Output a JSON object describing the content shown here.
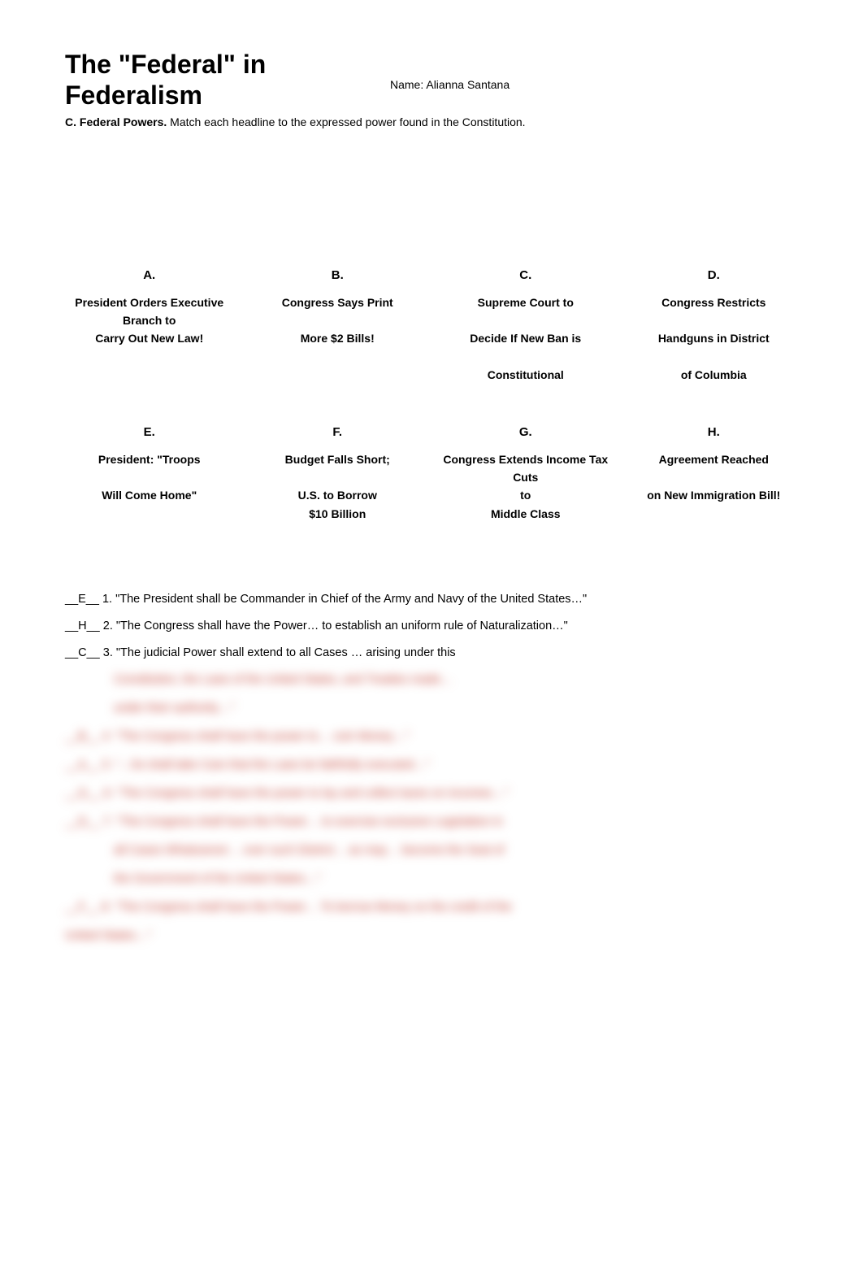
{
  "title_line1": "The \"Federal\" in",
  "title_line2": "Federalism",
  "name_label": "Name: ",
  "name_value": "Alianna Santana",
  "instructions_bold": "C. Federal Powers.",
  "instructions_rest": " Match each headline to the expressed power found in the Constitution.",
  "headlines": {
    "row1": [
      {
        "letter": "A.",
        "text": "President Orders Executive Branch to\nCarry Out New Law!"
      },
      {
        "letter": "B.",
        "text": "Congress Says Print\n \nMore $2 Bills!"
      },
      {
        "letter": "C.",
        "text": "Supreme Court to\n \nDecide If New Ban is\n \nConstitutional"
      },
      {
        "letter": "D.",
        "text": "Congress Restricts\n \nHandguns in District\n \nof Columbia"
      }
    ],
    "row2": [
      {
        "letter": "E.",
        "text": "President: \"Troops\n \nWill Come Home\""
      },
      {
        "letter": "F.",
        "text": "Budget Falls Short;\n \nU.S. to Borrow\n$10 Billion"
      },
      {
        "letter": "G.",
        "text": "Congress Extends Income Tax Cuts\nto\nMiddle Class"
      },
      {
        "letter": "H.",
        "text": "Agreement Reached\n \non New Immigration Bill!"
      }
    ]
  },
  "questions": {
    "q1": "__E__ 1. \"The President shall be Commander in Chief of the Army and Navy of the United States…\"",
    "q2": " __H__ 2. \"The Congress shall have the Power… to establish an uniform rule of Naturalization…\"",
    "q3_visible": "__C__ 3. \"The judicial Power shall extend to all Cases … arising under this",
    "q3_blurred1": "Constitution, the Laws of the United States, and Treaties made…",
    "q3_blurred2": "under their authority…\"",
    "q4": "__B__ 4. \"The Congress shall have the power to… coin Money…\"",
    "q5": "__A__ 5. \"…he shall take Care that the Laws be faithfully executed…\"",
    "q6": "__G__ 6. \"The Congress shall have the power to lay and collect taxes on incomes…\"",
    "q7a": "__D__ 7. \"The Congress shall have the Power… to exercise exclusive Legislation in",
    "q7b": "all Cases Whatsoever… over such District… as may… become the Seat of",
    "q7c": "the Government of the United States…\"",
    "q8a": "__F__ 8. \"The Congress shall have the Power… To borrow Money on the credit of the",
    "q8b": "United States…\""
  }
}
